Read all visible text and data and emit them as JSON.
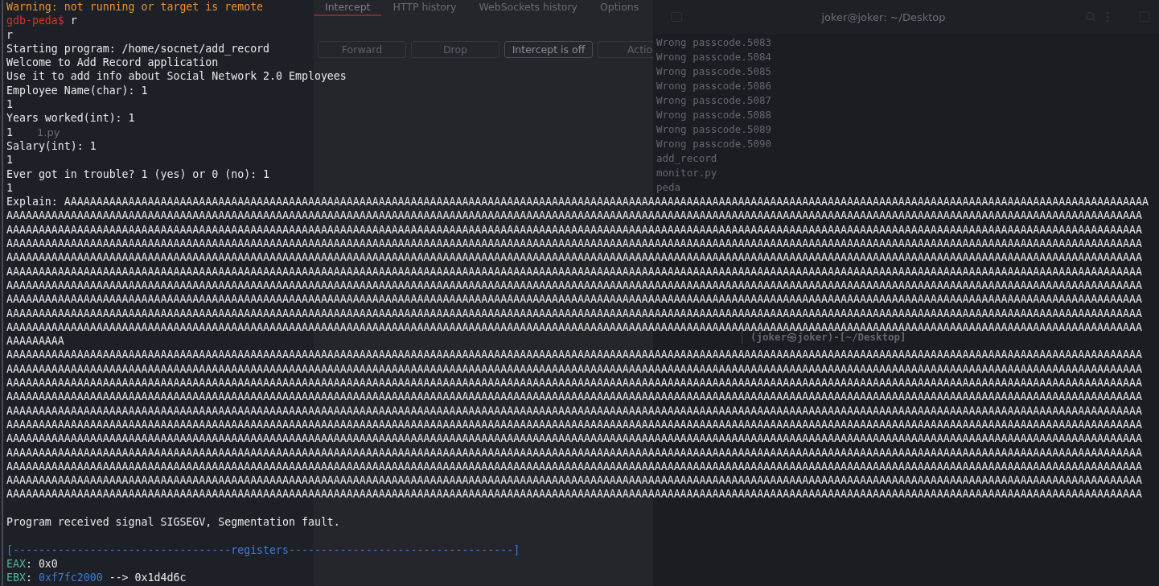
{
  "desktop_icons": [
    {
      "label": "1.py"
    }
  ],
  "proxy_window": {
    "tabs": [
      {
        "label": "Intercept",
        "selected": true
      },
      {
        "label": "HTTP history",
        "selected": false
      },
      {
        "label": "WebSockets history",
        "selected": false
      },
      {
        "label": "Options",
        "selected": false
      }
    ],
    "buttons": [
      {
        "label": "Forward",
        "disabled": true
      },
      {
        "label": "Drop",
        "disabled": true
      },
      {
        "label": "Intercept is off",
        "disabled": false
      },
      {
        "label": "Actio",
        "disabled": true
      }
    ]
  },
  "back_terminal": {
    "title": "joker@joker: ~/Desktop",
    "lines": [
      "Wrong passcode.5083",
      "Wrong passcode.5084",
      "Wrong passcode.5085",
      "Wrong passcode.5086",
      "Wrong passcode.5087",
      "Wrong passcode.5088",
      "Wrong passcode.5089",
      "Wrong passcode.5090",
      "add_record",
      "monitor.py",
      "peda"
    ],
    "prompt": "(joker㉿joker)-[~/Desktop]"
  },
  "terminal": {
    "lines": [
      {
        "kind": "text",
        "segments": [
          {
            "kind": "warning",
            "text": "Warning: not running or target is remote"
          }
        ]
      },
      {
        "kind": "text",
        "segments": [
          {
            "kind": "prompt",
            "text": "gdb-peda$"
          },
          {
            "kind": "plain",
            "text": " r"
          }
        ]
      },
      {
        "kind": "text",
        "segments": [
          {
            "kind": "plain",
            "text": "r"
          }
        ]
      },
      {
        "kind": "text",
        "segments": [
          {
            "kind": "plain",
            "text": "Starting program: /home/socnet/add_record"
          }
        ]
      },
      {
        "kind": "text",
        "segments": [
          {
            "kind": "plain",
            "text": "Welcome to Add Record application"
          }
        ]
      },
      {
        "kind": "text",
        "segments": [
          {
            "kind": "plain",
            "text": "Use it to add info about Social Network 2.0 Employees"
          }
        ]
      },
      {
        "kind": "text",
        "segments": [
          {
            "kind": "plain",
            "text": "Employee Name(char): 1"
          }
        ]
      },
      {
        "kind": "text",
        "segments": [
          {
            "kind": "plain",
            "text": "1"
          }
        ]
      },
      {
        "kind": "text",
        "segments": [
          {
            "kind": "plain",
            "text": "Years worked(int): 1"
          }
        ]
      },
      {
        "kind": "text",
        "segments": [
          {
            "kind": "plain",
            "text": "1"
          }
        ]
      },
      {
        "kind": "text",
        "segments": [
          {
            "kind": "plain",
            "text": "Salary(int): 1"
          }
        ]
      },
      {
        "kind": "text",
        "segments": [
          {
            "kind": "plain",
            "text": "1"
          }
        ]
      },
      {
        "kind": "text",
        "segments": [
          {
            "kind": "plain",
            "text": "Ever got in trouble? 1 (yes) or 0 (no): 1"
          }
        ]
      },
      {
        "kind": "text",
        "segments": [
          {
            "kind": "plain",
            "text": "1"
          }
        ]
      },
      {
        "kind": "text",
        "segments": [
          {
            "kind": "plain",
            "text": "Explain: AAAAAAAAAAAAAAAAAAAAAAAAAAAAAAAAAAAAAAAAAAAAAAAAAAAAAAAAAAAAAAAAAAAAAAAAAAAAAAAAAAAAAAAAAAAAAAAAAAAAAAAAAAAAAAAAAAAAAAAAAAAAAAAAAAAAAAAAAAAAAAAAAAAAAAAAAAAAAAAAAAAAAAAAA"
          }
        ]
      },
      {
        "kind": "text",
        "segments": [
          {
            "kind": "plain",
            "text": "AAAAAAAAAAAAAAAAAAAAAAAAAAAAAAAAAAAAAAAAAAAAAAAAAAAAAAAAAAAAAAAAAAAAAAAAAAAAAAAAAAAAAAAAAAAAAAAAAAAAAAAAAAAAAAAAAAAAAAAAAAAAAAAAAAAAAAAAAAAAAAAAAAAAAAAAAAAAAAAAAAAAAAAAAAAAAAAAA"
          }
        ]
      },
      {
        "kind": "text",
        "segments": [
          {
            "kind": "plain",
            "text": "AAAAAAAAAAAAAAAAAAAAAAAAAAAAAAAAAAAAAAAAAAAAAAAAAAAAAAAAAAAAAAAAAAAAAAAAAAAAAAAAAAAAAAAAAAAAAAAAAAAAAAAAAAAAAAAAAAAAAAAAAAAAAAAAAAAAAAAAAAAAAAAAAAAAAAAAAAAAAAAAAAAAAAAAAAAAAAAAA"
          }
        ]
      },
      {
        "kind": "text",
        "segments": [
          {
            "kind": "plain",
            "text": "AAAAAAAAAAAAAAAAAAAAAAAAAAAAAAAAAAAAAAAAAAAAAAAAAAAAAAAAAAAAAAAAAAAAAAAAAAAAAAAAAAAAAAAAAAAAAAAAAAAAAAAAAAAAAAAAAAAAAAAAAAAAAAAAAAAAAAAAAAAAAAAAAAAAAAAAAAAAAAAAAAAAAAAAAAAAAAAAA"
          }
        ]
      },
      {
        "kind": "text",
        "segments": [
          {
            "kind": "plain",
            "text": "AAAAAAAAAAAAAAAAAAAAAAAAAAAAAAAAAAAAAAAAAAAAAAAAAAAAAAAAAAAAAAAAAAAAAAAAAAAAAAAAAAAAAAAAAAAAAAAAAAAAAAAAAAAAAAAAAAAAAAAAAAAAAAAAAAAAAAAAAAAAAAAAAAAAAAAAAAAAAAAAAAAAAAAAAAAAAAAAA"
          }
        ]
      },
      {
        "kind": "text",
        "segments": [
          {
            "kind": "plain",
            "text": "AAAAAAAAAAAAAAAAAAAAAAAAAAAAAAAAAAAAAAAAAAAAAAAAAAAAAAAAAAAAAAAAAAAAAAAAAAAAAAAAAAAAAAAAAAAAAAAAAAAAAAAAAAAAAAAAAAAAAAAAAAAAAAAAAAAAAAAAAAAAAAAAAAAAAAAAAAAAAAAAAAAAAAAAAAAAAAAAA"
          }
        ]
      },
      {
        "kind": "text",
        "segments": [
          {
            "kind": "plain",
            "text": "AAAAAAAAAAAAAAAAAAAAAAAAAAAAAAAAAAAAAAAAAAAAAAAAAAAAAAAAAAAAAAAAAAAAAAAAAAAAAAAAAAAAAAAAAAAAAAAAAAAAAAAAAAAAAAAAAAAAAAAAAAAAAAAAAAAAAAAAAAAAAAAAAAAAAAAAAAAAAAAAAAAAAAAAAAAAAAAAA"
          }
        ]
      },
      {
        "kind": "text",
        "segments": [
          {
            "kind": "plain",
            "text": "AAAAAAAAAAAAAAAAAAAAAAAAAAAAAAAAAAAAAAAAAAAAAAAAAAAAAAAAAAAAAAAAAAAAAAAAAAAAAAAAAAAAAAAAAAAAAAAAAAAAAAAAAAAAAAAAAAAAAAAAAAAAAAAAAAAAAAAAAAAAAAAAAAAAAAAAAAAAAAAAAAAAAAAAAAAAAAAAA"
          }
        ]
      },
      {
        "kind": "text",
        "segments": [
          {
            "kind": "plain",
            "text": "AAAAAAAAAAAAAAAAAAAAAAAAAAAAAAAAAAAAAAAAAAAAAAAAAAAAAAAAAAAAAAAAAAAAAAAAAAAAAAAAAAAAAAAAAAAAAAAAAAAAAAAAAAAAAAAAAAAAAAAAAAAAAAAAAAAAAAAAAAAAAAAAAAAAAAAAAAAAAAAAAAAAAAAAAAAAAAAAA"
          }
        ]
      },
      {
        "kind": "text",
        "segments": [
          {
            "kind": "plain",
            "text": "AAAAAAAAAAAAAAAAAAAAAAAAAAAAAAAAAAAAAAAAAAAAAAAAAAAAAAAAAAAAAAAAAAAAAAAAAAAAAAAAAAAAAAAAAAAAAAAAAAAAAAAAAAAAAAAAAAAAAAAAAAAAAAAAAAAAAAAAAAAAAAAAAAAAAAAAAAAAAAAAAAAAAAAAAAAAAAAAA"
          }
        ]
      },
      {
        "kind": "text",
        "segments": [
          {
            "kind": "plain",
            "text": "AAAAAAAAA"
          }
        ]
      },
      {
        "kind": "text",
        "segments": [
          {
            "kind": "plain",
            "text": "AAAAAAAAAAAAAAAAAAAAAAAAAAAAAAAAAAAAAAAAAAAAAAAAAAAAAAAAAAAAAAAAAAAAAAAAAAAAAAAAAAAAAAAAAAAAAAAAAAAAAAAAAAAAAAAAAAAAAAAAAAAAAAAAAAAAAAAAAAAAAAAAAAAAAAAAAAAAAAAAAAAAAAAAAAAAAAAAA"
          }
        ]
      },
      {
        "kind": "text",
        "segments": [
          {
            "kind": "plain",
            "text": "AAAAAAAAAAAAAAAAAAAAAAAAAAAAAAAAAAAAAAAAAAAAAAAAAAAAAAAAAAAAAAAAAAAAAAAAAAAAAAAAAAAAAAAAAAAAAAAAAAAAAAAAAAAAAAAAAAAAAAAAAAAAAAAAAAAAAAAAAAAAAAAAAAAAAAAAAAAAAAAAAAAAAAAAAAAAAAAAA"
          }
        ]
      },
      {
        "kind": "text",
        "segments": [
          {
            "kind": "plain",
            "text": "AAAAAAAAAAAAAAAAAAAAAAAAAAAAAAAAAAAAAAAAAAAAAAAAAAAAAAAAAAAAAAAAAAAAAAAAAAAAAAAAAAAAAAAAAAAAAAAAAAAAAAAAAAAAAAAAAAAAAAAAAAAAAAAAAAAAAAAAAAAAAAAAAAAAAAAAAAAAAAAAAAAAAAAAAAAAAAAAA"
          }
        ]
      },
      {
        "kind": "text",
        "segments": [
          {
            "kind": "plain",
            "text": "AAAAAAAAAAAAAAAAAAAAAAAAAAAAAAAAAAAAAAAAAAAAAAAAAAAAAAAAAAAAAAAAAAAAAAAAAAAAAAAAAAAAAAAAAAAAAAAAAAAAAAAAAAAAAAAAAAAAAAAAAAAAAAAAAAAAAAAAAAAAAAAAAAAAAAAAAAAAAAAAAAAAAAAAAAAAAAAAA"
          }
        ]
      },
      {
        "kind": "text",
        "segments": [
          {
            "kind": "plain",
            "text": "AAAAAAAAAAAAAAAAAAAAAAAAAAAAAAAAAAAAAAAAAAAAAAAAAAAAAAAAAAAAAAAAAAAAAAAAAAAAAAAAAAAAAAAAAAAAAAAAAAAAAAAAAAAAAAAAAAAAAAAAAAAAAAAAAAAAAAAAAAAAAAAAAAAAAAAAAAAAAAAAAAAAAAAAAAAAAAAAA"
          }
        ]
      },
      {
        "kind": "text",
        "segments": [
          {
            "kind": "plain",
            "text": "AAAAAAAAAAAAAAAAAAAAAAAAAAAAAAAAAAAAAAAAAAAAAAAAAAAAAAAAAAAAAAAAAAAAAAAAAAAAAAAAAAAAAAAAAAAAAAAAAAAAAAAAAAAAAAAAAAAAAAAAAAAAAAAAAAAAAAAAAAAAAAAAAAAAAAAAAAAAAAAAAAAAAAAAAAAAAAAAA"
          }
        ]
      },
      {
        "kind": "text",
        "segments": [
          {
            "kind": "plain",
            "text": "AAAAAAAAAAAAAAAAAAAAAAAAAAAAAAAAAAAAAAAAAAAAAAAAAAAAAAAAAAAAAAAAAAAAAAAAAAAAAAAAAAAAAAAAAAAAAAAAAAAAAAAAAAAAAAAAAAAAAAAAAAAAAAAAAAAAAAAAAAAAAAAAAAAAAAAAAAAAAAAAAAAAAAAAAAAAAAAAA"
          }
        ]
      },
      {
        "kind": "text",
        "segments": [
          {
            "kind": "plain",
            "text": "AAAAAAAAAAAAAAAAAAAAAAAAAAAAAAAAAAAAAAAAAAAAAAAAAAAAAAAAAAAAAAAAAAAAAAAAAAAAAAAAAAAAAAAAAAAAAAAAAAAAAAAAAAAAAAAAAAAAAAAAAAAAAAAAAAAAAAAAAAAAAAAAAAAAAAAAAAAAAAAAAAAAAAAAAAAAAAAAA"
          }
        ]
      },
      {
        "kind": "text",
        "segments": [
          {
            "kind": "plain",
            "text": "AAAAAAAAAAAAAAAAAAAAAAAAAAAAAAAAAAAAAAAAAAAAAAAAAAAAAAAAAAAAAAAAAAAAAAAAAAAAAAAAAAAAAAAAAAAAAAAAAAAAAAAAAAAAAAAAAAAAAAAAAAAAAAAAAAAAAAAAAAAAAAAAAAAAAAAAAAAAAAAAAAAAAAAAAAAAAAAAA"
          }
        ]
      },
      {
        "kind": "text",
        "segments": [
          {
            "kind": "plain",
            "text": "AAAAAAAAAAAAAAAAAAAAAAAAAAAAAAAAAAAAAAAAAAAAAAAAAAAAAAAAAAAAAAAAAAAAAAAAAAAAAAAAAAAAAAAAAAAAAAAAAAAAAAAAAAAAAAAAAAAAAAAAAAAAAAAAAAAAAAAAAAAAAAAAAAAAAAAAAAAAAAAAAAAAAAAAAAAAAAAAA"
          }
        ]
      },
      {
        "kind": "text",
        "segments": [
          {
            "kind": "plain",
            "text": "AAAAAAAAAAAAAAAAAAAAAAAAAAAAAAAAAAAAAAAAAAAAAAAAAAAAAAAAAAAAAAAAAAAAAAAAAAAAAAAAAAAAAAAAAAAAAAAAAAAAAAAAAAAAAAAAAAAAAAAAAAAAAAAAAAAAAAAAAAAAAAAAAAAAAAAAAAAAAAAAAAAAAAAAAAAAAAAAA"
          }
        ]
      },
      {
        "kind": "blank"
      },
      {
        "kind": "text",
        "segments": [
          {
            "kind": "plain",
            "text": "Program received signal SIGSEGV, Segmentation fault."
          }
        ]
      },
      {
        "kind": "blank"
      },
      {
        "kind": "text",
        "segments": [
          {
            "kind": "rule",
            "text": "[----------------------------------registers-----------------------------------]"
          }
        ]
      },
      {
        "kind": "text",
        "segments": [
          {
            "kind": "register",
            "text": "EAX"
          },
          {
            "kind": "plain",
            "text": ": 0x0"
          }
        ]
      },
      {
        "kind": "text",
        "segments": [
          {
            "kind": "register",
            "text": "EBX"
          },
          {
            "kind": "plain",
            "text": ": "
          },
          {
            "kind": "pointer",
            "text": "0xf7fc2000"
          },
          {
            "kind": "plain",
            "text": " --> 0x1d4d6c"
          }
        ]
      }
    ]
  }
}
